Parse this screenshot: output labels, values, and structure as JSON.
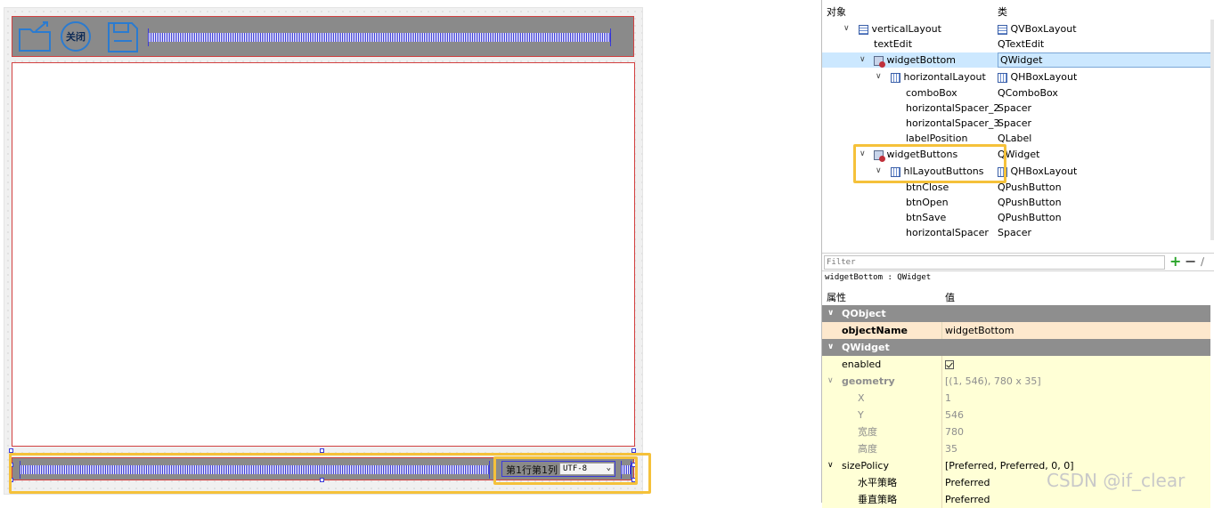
{
  "colors": {
    "selection": "#cce8ff",
    "highlight": "#f5c13a",
    "layout_blue": "#3a3ad8",
    "widget_border": "#d24040",
    "group_gray": "#8e8e8e",
    "property_yellow": "#ffffd6",
    "property_peach": "#fde8cd"
  },
  "canvas": {
    "top_bar": {
      "open_icon": "folder-open-icon",
      "close_label": "关闭",
      "save_icon": "save-icon"
    },
    "bottom_bar": {
      "label_position": "第1行第1列",
      "encoding": "UTF-8"
    }
  },
  "object_tree": {
    "headers": {
      "object": "对象",
      "class": "类"
    },
    "items": [
      {
        "name": "verticalLayout",
        "class": "QVBoxLayout",
        "icon": "vbox-layout-icon",
        "expanded": true
      },
      {
        "name": "textEdit",
        "class": "QTextEdit"
      },
      {
        "name": "widgetBottom",
        "class": "QWidget",
        "icon": "widget-icon",
        "expanded": true,
        "selected": true
      },
      {
        "name": "horizontalLayout",
        "class": "QHBoxLayout",
        "icon": "hbox-layout-icon",
        "expanded": true
      },
      {
        "name": "comboBox",
        "class": "QComboBox"
      },
      {
        "name": "horizontalSpacer_2",
        "class": "Spacer"
      },
      {
        "name": "horizontalSpacer_3",
        "class": "Spacer"
      },
      {
        "name": "labelPosition",
        "class": "QLabel"
      },
      {
        "name": "widgetButtons",
        "class": "QWidget",
        "icon": "widget-icon",
        "expanded": true
      },
      {
        "name": "hlLayoutButtons",
        "class": "QHBoxLayout",
        "icon": "hbox-layout-icon",
        "expanded": true
      },
      {
        "name": "btnClose",
        "class": "QPushButton"
      },
      {
        "name": "btnOpen",
        "class": "QPushButton"
      },
      {
        "name": "btnSave",
        "class": "QPushButton"
      },
      {
        "name": "horizontalSpacer",
        "class": "Spacer"
      }
    ]
  },
  "filter": {
    "placeholder": "Filter"
  },
  "selected_object": "widgetBottom : QWidget",
  "property_editor": {
    "headers": {
      "property": "属性",
      "value": "值"
    },
    "rows": [
      {
        "kind": "group",
        "name": "QObject"
      },
      {
        "kind": "prop",
        "name": "objectName",
        "value": "widgetBottom"
      },
      {
        "kind": "group",
        "name": "QWidget"
      },
      {
        "kind": "prop",
        "name": "enabled",
        "value": "checked"
      },
      {
        "kind": "prop",
        "name": "geometry",
        "value": "[(1, 546), 780 x 35]"
      },
      {
        "kind": "sub",
        "name": "X",
        "value": "1"
      },
      {
        "kind": "sub",
        "name": "Y",
        "value": "546"
      },
      {
        "kind": "sub",
        "name": "宽度",
        "value": "780"
      },
      {
        "kind": "sub",
        "name": "高度",
        "value": "35"
      },
      {
        "kind": "prop",
        "name": "sizePolicy",
        "value": "[Preferred, Preferred, 0, 0]"
      },
      {
        "kind": "sub",
        "name": "水平策略",
        "value": "Preferred"
      },
      {
        "kind": "sub",
        "name": "垂直策略",
        "value": "Preferred"
      }
    ]
  },
  "watermark": "CSDN @if_clear"
}
